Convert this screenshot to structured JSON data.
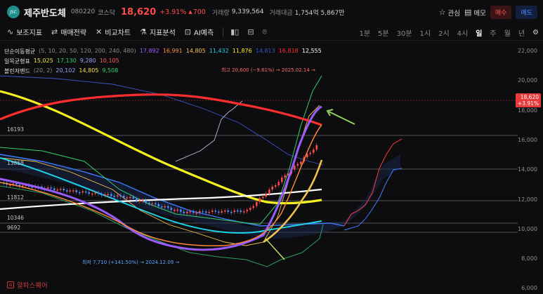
{
  "header": {
    "logo_text": "JSC",
    "stock_name": "제주반도체",
    "stock_code": "080220",
    "market": "코스닥",
    "price": "18,620",
    "change_pct": "+3.91%",
    "change_abs": "700",
    "volume_label": "거래량",
    "volume": "9,339,564",
    "amount_label": "거래대금",
    "amount": "1,754억 5,867만",
    "watch_label": "관심",
    "memo_label": "메모",
    "buy_label": "매수",
    "sell_label": "매도"
  },
  "toolbar": {
    "indicators": "보조지표",
    "strategy": "매매전략",
    "compare": "비교차트",
    "analysis": "지표분석",
    "ai_label": "AI예측",
    "periods": [
      "1분",
      "5분",
      "30분",
      "1시",
      "2시",
      "4시",
      "일",
      "주",
      "월",
      "년"
    ],
    "active_period": "일"
  },
  "legend": {
    "ma": {
      "name": "단순이동평균",
      "params": "(5, 10, 20, 50, 120, 200, 240, 480)",
      "values": [
        "17,892",
        "16,991",
        "14,805",
        "11,432",
        "11,876",
        "14,813",
        "16,818",
        "12,555"
      ]
    },
    "ichimoku": {
      "name": "일목균형표",
      "values": [
        "15,025",
        "17,130",
        "9,280",
        "10,105"
      ]
    },
    "bollinger": {
      "name": "볼린저밴드",
      "params": "(20, 2)",
      "values": [
        "20,102",
        "14,805",
        "9,508"
      ]
    }
  },
  "chart": {
    "y_ticks": [
      "22,000",
      "20,000",
      "18,000",
      "16,000",
      "14,000",
      "12,000",
      "10,000",
      "8,000",
      "6,000"
    ],
    "current_price_tag": "18,620",
    "current_change_tag": "+3.91%",
    "high_label": "최고 20,600 (−9.61%) → 2025.02.14 →",
    "low_label": "최저 7,710 (+141.50%) → 2024.12.09 →",
    "level_labels": [
      "16193",
      "13858",
      "11812",
      "10346",
      "9692"
    ]
  },
  "colors": {
    "up": "#ff4a4a",
    "down": "#4d8dff",
    "ma5": "#9b5cff",
    "ma10": "#ff8a3d",
    "ma20": "#f0c14b",
    "ma50": "#1fd3e6",
    "ma120": "#f4f21e",
    "ma200": "#3b55c9",
    "ma240": "#ff2e2e",
    "ma480": "#ffffff",
    "ichi1": "#f0e04b",
    "ichi2": "#2fd06a",
    "ichi3": "#9aa0ff",
    "ichi4": "#ff5b5b"
  },
  "watermark": "알파스퀘어"
}
